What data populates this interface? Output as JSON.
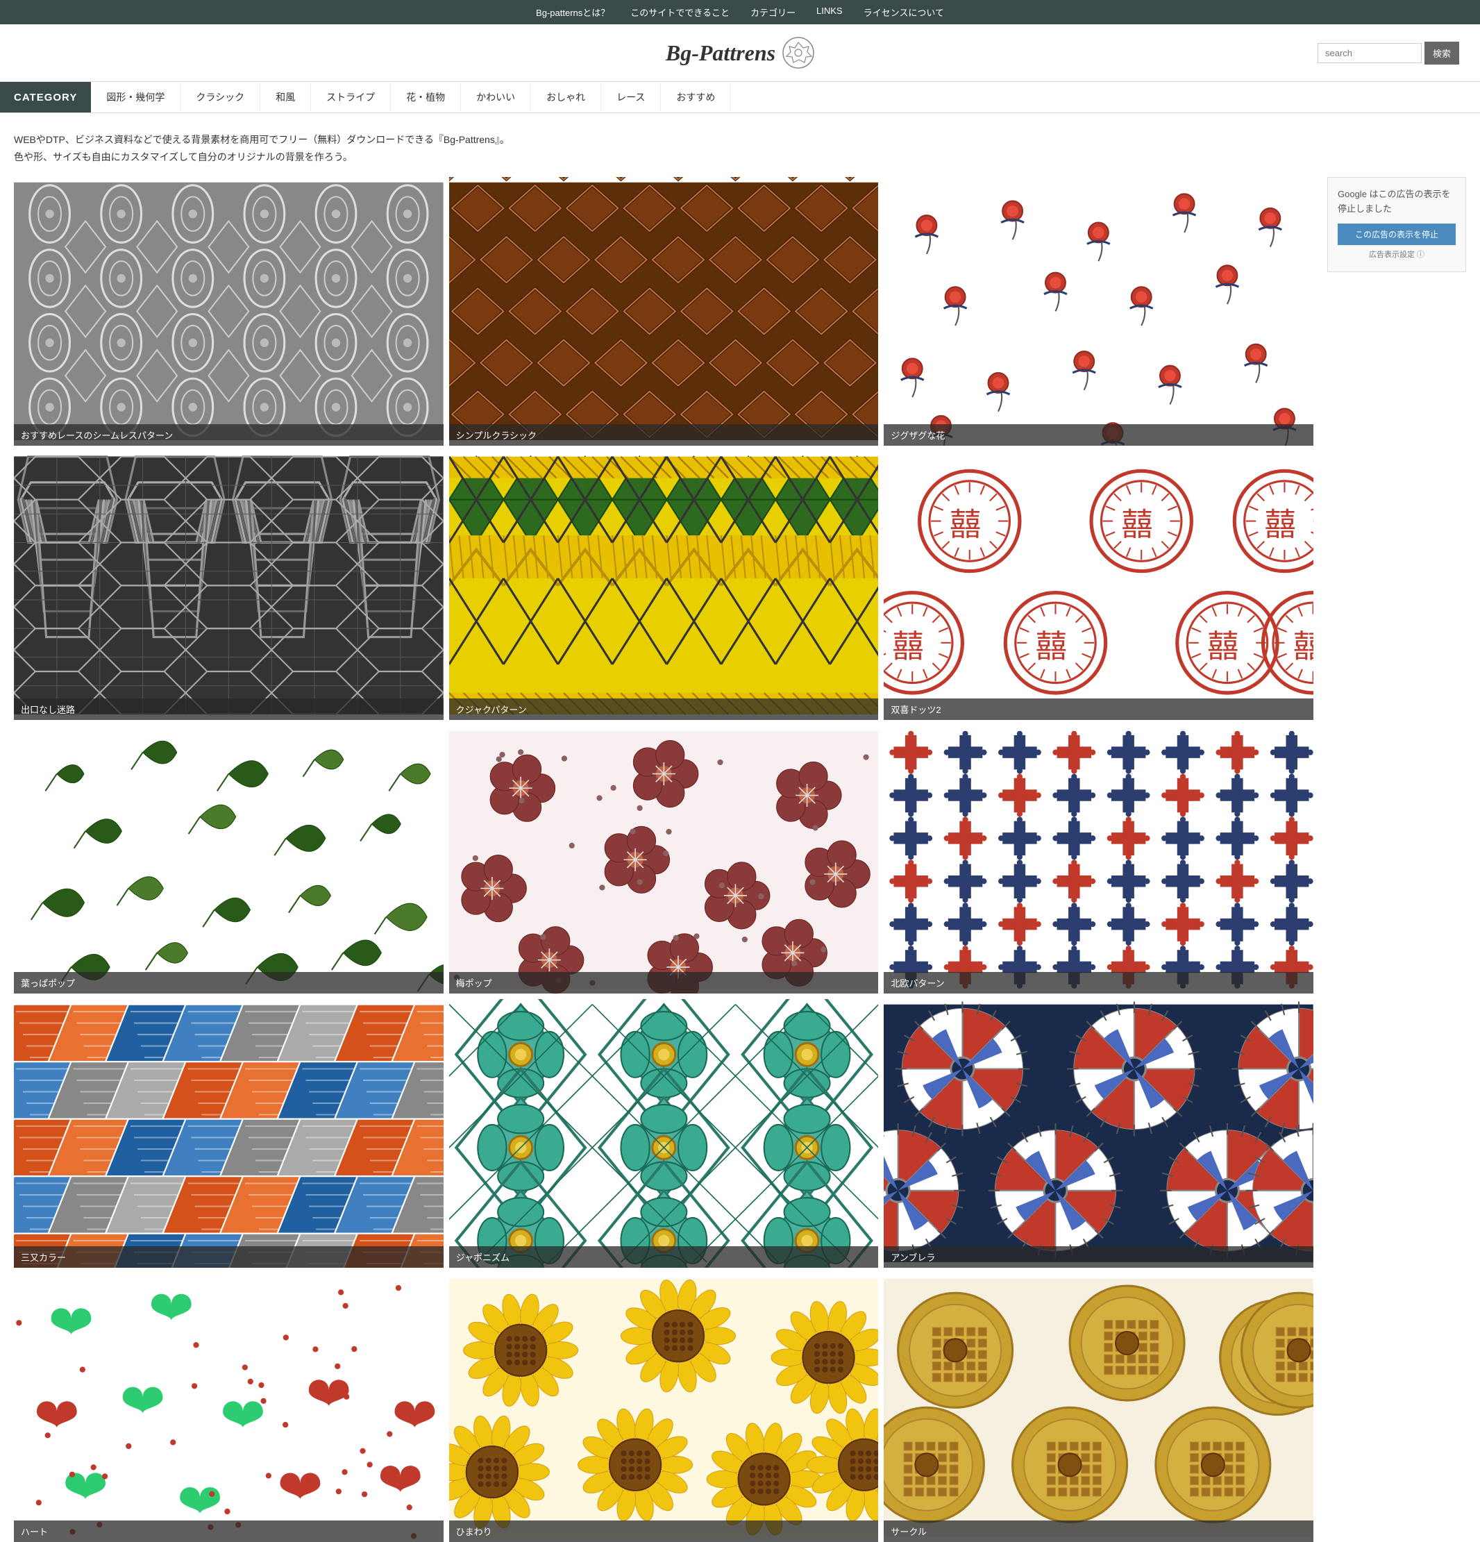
{
  "topnav": {
    "items": [
      "Bg-patternsとは？",
      "このサイトでできること",
      "カテゴリー",
      "LINKS",
      "ライセンスについて"
    ]
  },
  "header": {
    "logo": "Bg-Pattrens",
    "search_placeholder": "search",
    "search_btn": "検索"
  },
  "category": {
    "label": "CATEGORY",
    "items": [
      "図形・幾何学",
      "クラシック",
      "和風",
      "ストライプ",
      "花・植物",
      "かわいい",
      "おしゃれ",
      "レース",
      "おすすめ"
    ]
  },
  "description": {
    "line1": "WEBやDTP、ビジネス資料などで使える背景素材を商用可でフリー（無料）ダウンロードできる『Bg-Pattrens』。",
    "line2": "色や形、サイズも自由にカスタマイズして自分のオリジナルの背景を作ろう。"
  },
  "patterns": [
    {
      "label": "おすすめレースのシームレスパターン",
      "type": "lace"
    },
    {
      "label": "シンプルクラシック",
      "type": "classic"
    },
    {
      "label": "ジグザグな花",
      "type": "zigzag_flower"
    },
    {
      "label": "出口なし迷路",
      "type": "maze"
    },
    {
      "label": "クジャクパターン",
      "type": "peacock"
    },
    {
      "label": "双喜ドッツ2",
      "type": "shuangxi"
    },
    {
      "label": "葉っぱポップ",
      "type": "leaf"
    },
    {
      "label": "梅ポップ",
      "type": "plum"
    },
    {
      "label": "北欧パターン",
      "type": "nordic"
    },
    {
      "label": "三又カラー",
      "type": "triangle"
    },
    {
      "label": "ジャポニズム",
      "type": "japonism"
    },
    {
      "label": "アンブレラ",
      "type": "umbrella"
    },
    {
      "label": "ハート",
      "type": "heart"
    },
    {
      "label": "ひまわり",
      "type": "sunflower"
    },
    {
      "label": "サークル",
      "type": "circle_pattern"
    }
  ],
  "sidebar": {
    "ad_text": "Google はこの広告の表示を停止しました",
    "ad_stop": "この広告の表示を停止",
    "ad_settings": "広告表示設定 ⓘ"
  }
}
